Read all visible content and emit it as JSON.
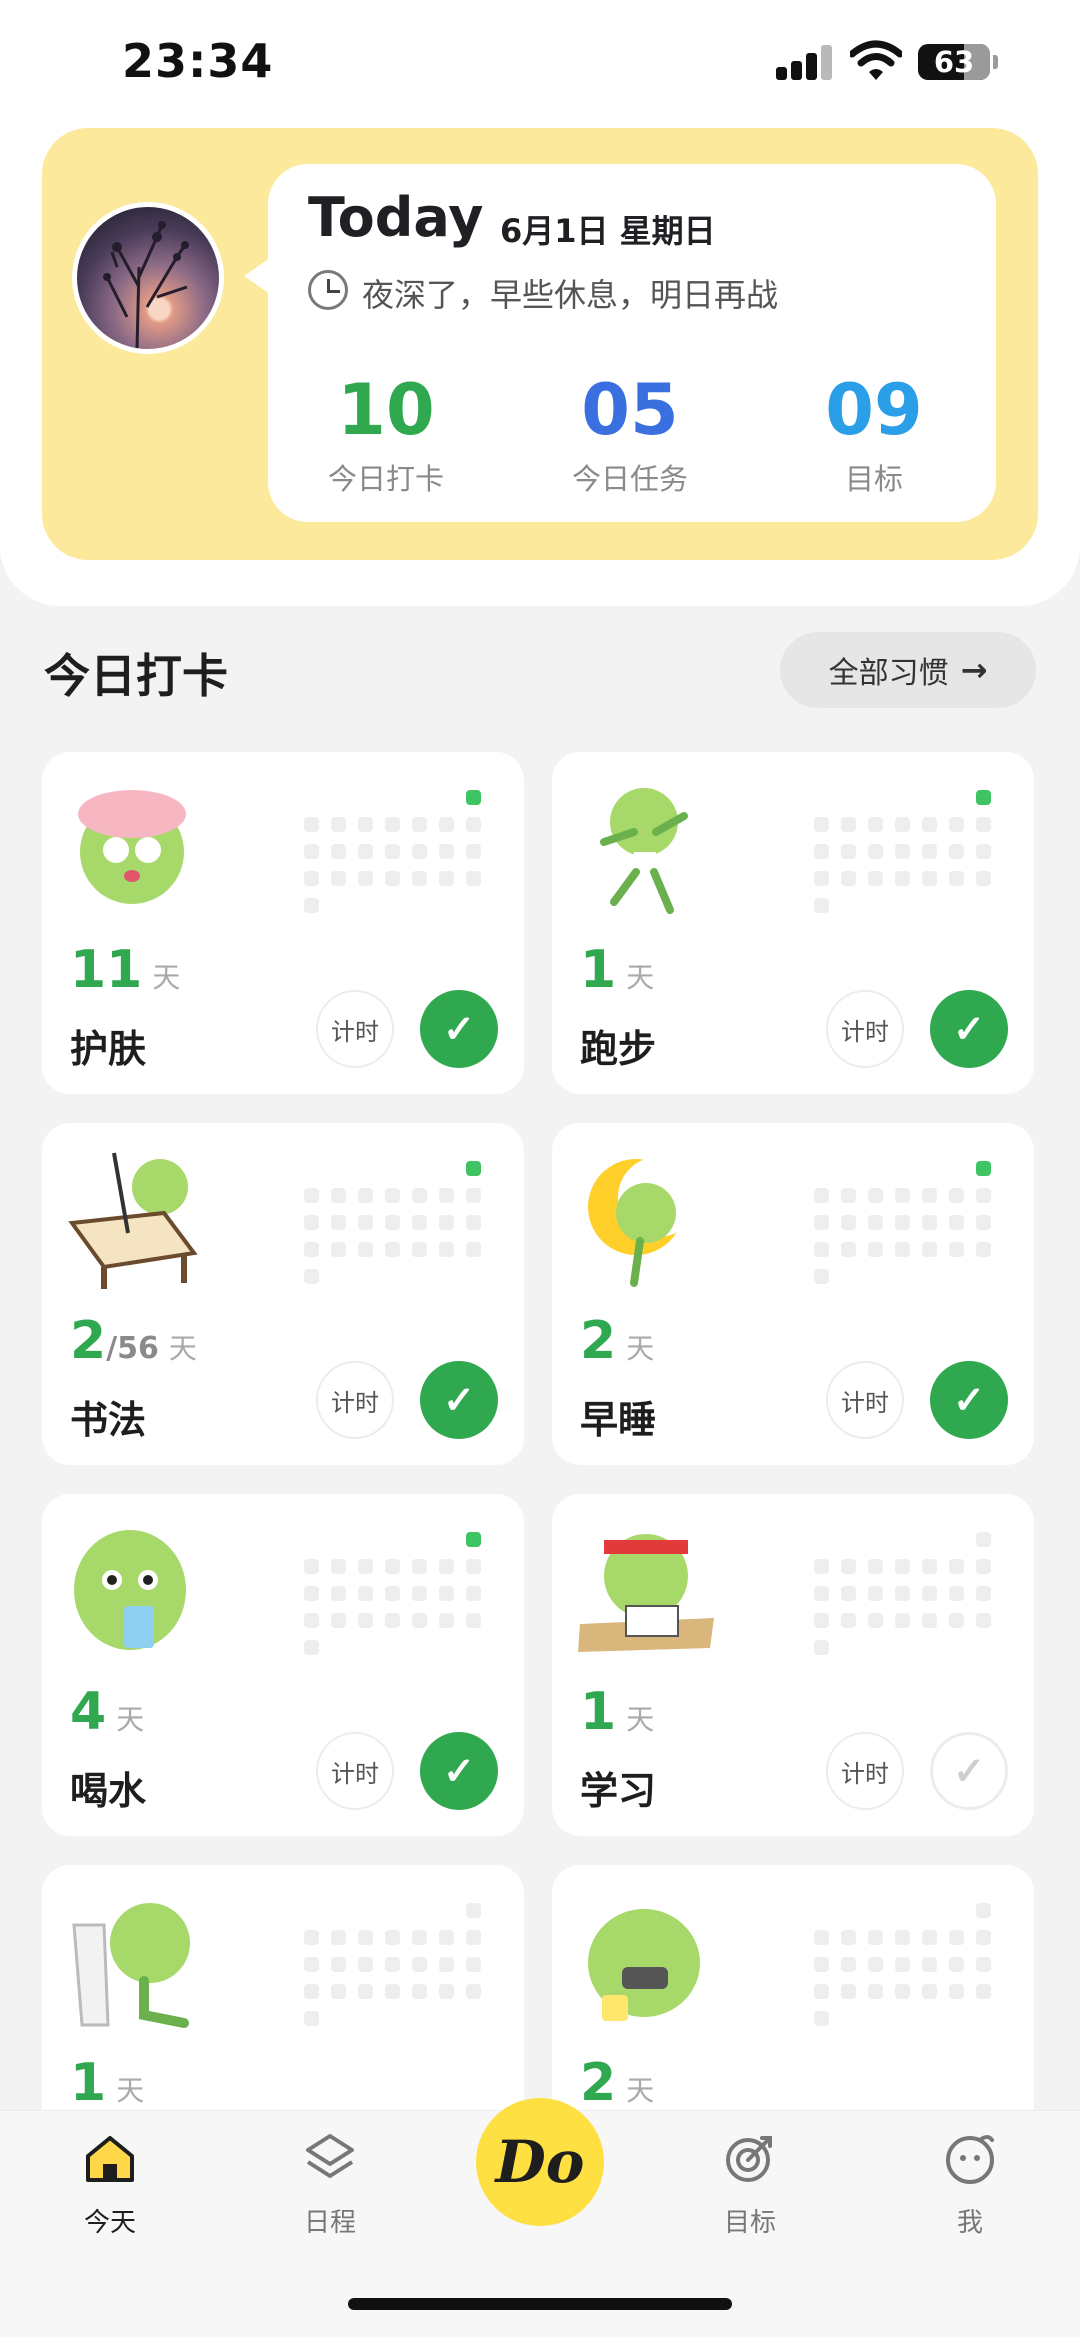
{
  "status_bar": {
    "time": "23:34",
    "battery": "63"
  },
  "header": {
    "title": "Today",
    "date": "6月1日 星期日",
    "greeting": "夜深了，早些休息，明日再战",
    "stats": [
      {
        "value": "10",
        "label": "今日打卡",
        "color": "#2fa84f"
      },
      {
        "value": "05",
        "label": "今日任务",
        "color": "#3a6fe0"
      },
      {
        "value": "09",
        "label": "目标",
        "color": "#2b9ee8"
      }
    ]
  },
  "section": {
    "title": "今日打卡",
    "all_habits_label": "全部习惯"
  },
  "habits": [
    {
      "days": "11",
      "total": "",
      "unit": "天",
      "name": "护肤",
      "timer_label": "计时",
      "checked": true,
      "mascot": "face-mask-icon"
    },
    {
      "days": "1",
      "total": "",
      "unit": "天",
      "name": "跑步",
      "timer_label": "计时",
      "checked": true,
      "mascot": "running-icon"
    },
    {
      "days": "2",
      "total": "/56",
      "unit": "天",
      "name": "书法",
      "timer_label": "计时",
      "checked": true,
      "mascot": "calligraphy-icon"
    },
    {
      "days": "2",
      "total": "",
      "unit": "天",
      "name": "早睡",
      "timer_label": "计时",
      "checked": true,
      "mascot": "moon-sleep-icon"
    },
    {
      "days": "4",
      "total": "",
      "unit": "天",
      "name": "喝水",
      "timer_label": "计时",
      "checked": true,
      "mascot": "drinking-icon"
    },
    {
      "days": "1",
      "total": "",
      "unit": "天",
      "name": "学习",
      "timer_label": "计时",
      "checked": false,
      "mascot": "studying-icon"
    },
    {
      "days": "1",
      "total": "",
      "unit": "天",
      "name": "",
      "timer_label": "",
      "checked": false,
      "mascot": "toilet-icon"
    },
    {
      "days": "2",
      "total": "",
      "unit": "天",
      "name": "",
      "timer_label": "",
      "checked": false,
      "mascot": "brushing-teeth-icon"
    }
  ],
  "nav": {
    "items": [
      {
        "label": "今天",
        "icon": "home-icon"
      },
      {
        "label": "日程",
        "icon": "layers-icon"
      },
      {
        "label": "目标",
        "icon": "target-icon"
      },
      {
        "label": "我",
        "icon": "profile-icon"
      }
    ],
    "center_label": "Do"
  },
  "colors": {
    "accent_green": "#2fa84f",
    "header_yellow": "#fde99c",
    "do_yellow": "#ffe042"
  }
}
